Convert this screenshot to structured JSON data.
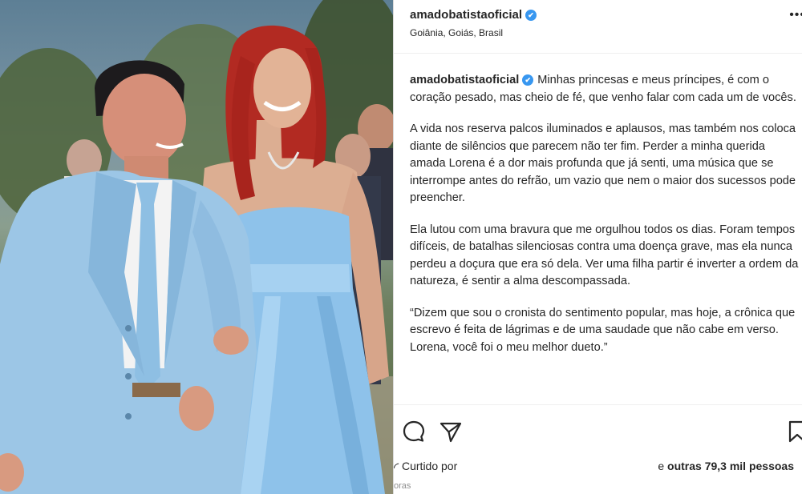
{
  "post": {
    "username": "amadobatistaoficial",
    "location": "Goiânia, Goiás, Brasil",
    "verified_mark": "✔",
    "more_icon": "•••"
  },
  "caption": {
    "username": "amadobatistaoficial",
    "p1": "Minhas princesas e meus príncipes, é com o coração pesado, mas cheio de fé, que venho falar com cada um de vocês.",
    "p2": "A vida nos reserva palcos iluminados e aplausos, mas também nos coloca diante de silêncios que parecem não ter fim. Perder a minha querida amada Lorena é a dor mais profunda que já senti, uma música que se interrompe antes do refrão, um vazio que nem o maior dos sucessos pode preencher.",
    "p3": "Ela lutou com uma bravura que me orgulhou todos os dias. Foram tempos difíceis, de batalhas silenciosas contra uma doença grave, mas ela nunca perdeu a doçura que era só dela. Ver uma filha partir é inverter a ordem da natureza, é sentir a alma descompassada.",
    "p4": "“Dizem que sou o cronista do sentimento popular, mas hoje, a crônica que escrevo é feita de lágrimas e de uma saudade que não cabe em verso. Lorena, você foi o meu melhor dueto.”"
  },
  "actions": {
    "icons": [
      "comment-icon",
      "share-icon",
      "save-icon"
    ],
    "liked_by": "Curtido por",
    "likes_prefix": "e ",
    "likes_count": "outras 79,3 mil pessoas",
    "tail": "oras"
  },
  "photo": {
    "suit_color": "#9cc6e6",
    "dress_color": "#8ec2ea",
    "hair_color": "#b22a22"
  }
}
